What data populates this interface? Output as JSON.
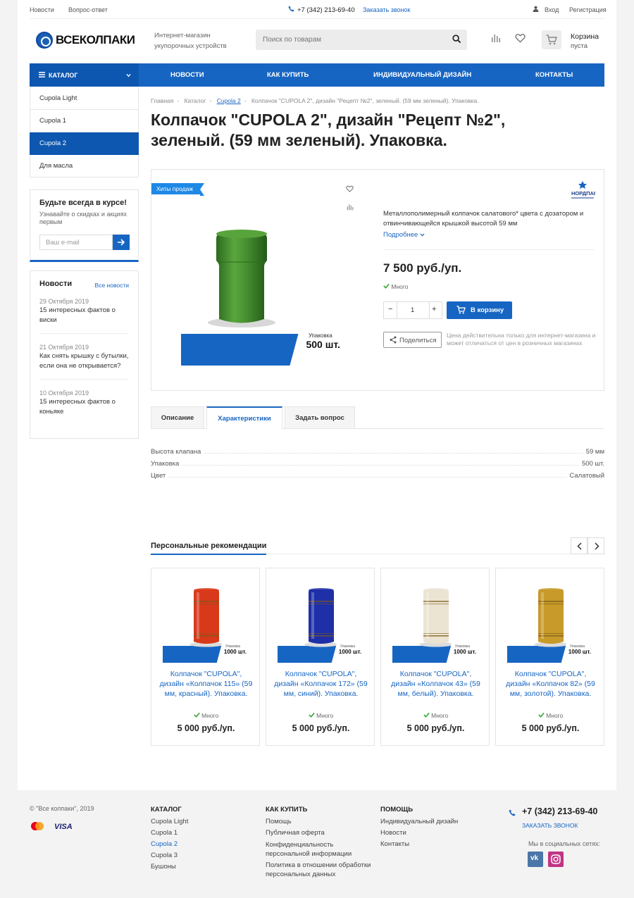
{
  "topbar": {
    "news": "Новости",
    "faq": "Вопрос-ответ",
    "phone": "+7 (342) 213-69-40",
    "callback": "Заказать звонок",
    "login": "Вход",
    "register": "Регистрация"
  },
  "header": {
    "logo": "ВСЕКОЛПАКИ",
    "tagline1": "Интернет-магазин",
    "tagline2": "укупорочных устройств",
    "search_placeholder": "Поиск по товарам",
    "cart_title": "Корзина",
    "cart_status": "пуста"
  },
  "nav": {
    "catalog": "КАТАЛОГ",
    "items": [
      "НОВОСТИ",
      "КАК КУПИТЬ",
      "ИНДИВИДУАЛЬНЫЙ ДИЗАЙН",
      "КОНТАКТЫ"
    ]
  },
  "sidebar": {
    "items": [
      "Cupola Light",
      "Cupola 1",
      "Cupola 2",
      "Для масла"
    ],
    "active_index": 2
  },
  "subscribe": {
    "title": "Будьте всегда в курсе!",
    "text": "Узнавайте о скидках и акциях первым",
    "placeholder": "Ваш e-mail"
  },
  "news": {
    "title": "Новости",
    "all": "Все новости",
    "items": [
      {
        "date": "29 Октября 2019",
        "title": "15 интересных фактов о виски"
      },
      {
        "date": "21 Октября 2019",
        "title": "Как снять крышку с бутылки, если она не открывается?"
      },
      {
        "date": "10 Октября 2019",
        "title": "15 интересных фактов о коньяке"
      }
    ]
  },
  "breadcrumbs": [
    "Главная",
    "Каталог",
    "Cupola 2",
    "Колпачок \"CUPOLA 2\", дизайн \"Рецепт №2\", зеленый. (59 мм зеленый). Упаковка."
  ],
  "product": {
    "title": "Колпачок \"CUPOLA 2\", дизайн \"Рецепт №2\", зеленый. (59 мм зеленый). Упаковка.",
    "badge": "Хиты продаж",
    "pack_label": "Упаковка",
    "pack_qty": "500 шт.",
    "brand": "НОРДПАК",
    "description": "Металлополимерный колпачок салатового* цвета с дозатором и отвинчивающейся крышкой высотой 59 мм",
    "more": "Подробнее",
    "price": "7 500 руб./уп.",
    "stock": "Много",
    "qty": "1",
    "buy": "В корзину",
    "share": "Поделиться",
    "note": "Цена действительна только для интернет-магазина и может отличаться от цен в розничных магазинах",
    "cap_color": "#3f8a2c"
  },
  "tabs": [
    "Описание",
    "Характеристики",
    "Задать вопрос"
  ],
  "properties": [
    {
      "k": "Высота клапана",
      "v": "59 мм"
    },
    {
      "k": "Упаковка",
      "v": "500 шт."
    },
    {
      "k": "Цвет",
      "v": "Салатовый"
    }
  ],
  "recs": {
    "title": "Персональные рекомендации",
    "items": [
      {
        "name": "Колпачок \"CUPOLA\", дизайн «Колпачок 115» (59 мм, красный). Упаковка.",
        "stock": "Много",
        "price": "5 000 руб./уп.",
        "pack": "Упаковка",
        "qty": "1000 шт.",
        "color": "#d9391b"
      },
      {
        "name": "Колпачок \"CUPOLA\", дизайн «Колпачок 172» (59 мм, синий). Упаковка.",
        "stock": "Много",
        "price": "5 000 руб./уп.",
        "pack": "Упаковка",
        "qty": "1000 шт.",
        "color": "#1f2fa8"
      },
      {
        "name": "Колпачок \"CUPOLA\", дизайн «Колпачок 43» (59 мм, белый). Упаковка.",
        "stock": "Много",
        "price": "5 000 руб./уп.",
        "pack": "Упаковка",
        "qty": "1000 шт.",
        "color": "#ece4d2"
      },
      {
        "name": "Колпачок \"CUPOLA\", дизайн «Колпачок 82» (59 мм, золотой). Упаковка.",
        "stock": "Много",
        "price": "5 000 руб./уп.",
        "pack": "Упаковка",
        "qty": "1000 шт.",
        "color": "#c79a2a"
      }
    ]
  },
  "footer": {
    "copy": "© \"Все колпаки\", 2019",
    "visa": "VISA",
    "col1": {
      "title": "КАТАЛОГ",
      "items": [
        "Cupola Light",
        "Cupola 1",
        "Cupola 2",
        "Cupola 3",
        "Бушоны"
      ]
    },
    "col2": {
      "title": "КАК КУПИТЬ",
      "items": [
        "Помощь",
        "Публичная оферта",
        "Конфиденциальность персональной информации",
        "Политика в отношении обработки персональных данных"
      ]
    },
    "col3": {
      "title": "ПОМОЩЬ",
      "items": [
        "Индивидуальный дизайн",
        "Новости",
        "Контакты"
      ]
    },
    "phone": "+7 (342) 213-69-40",
    "callback": "ЗАКАЗАТЬ ЗВОНОК",
    "social": "Мы в социальных сетях:",
    "vk": "vk"
  }
}
